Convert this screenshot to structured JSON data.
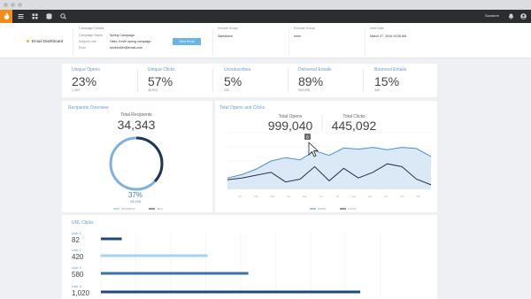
{
  "header": {
    "dashboard_title": "Email Dashboard",
    "campaign_details_label": "Campaign Details",
    "campaign_name_label": "Campaign Name",
    "campaign_name": "Spring Campaign",
    "subject_line_label": "Subject Line",
    "subject_line": "Hello, Kevin spring campaign",
    "from_label": "From",
    "from": "kevinmiller@email.com",
    "view_email_button": "View Email",
    "include_group_label": "Include Group",
    "include_group": "Salesforce",
    "exclude_group_label": "Exclude Group",
    "exclude_group": "none",
    "sent_date_label": "Sent Date",
    "sent_date": "March 27, 2016 10:55 AM"
  },
  "topbar": {
    "user_name": "Suzanne"
  },
  "stats": [
    {
      "label": "Unique Opens",
      "value": "23%",
      "sub": "1,409"
    },
    {
      "label": "Unique Clicks",
      "value": "57%",
      "sub": "38,903"
    },
    {
      "label": "Unsubscribes",
      "value": "5%",
      "sub": "200"
    },
    {
      "label": "Delivered Emails",
      "value": "89%",
      "sub": "383,998"
    },
    {
      "label": "Bounced Emails",
      "value": "15%",
      "sub": "349"
    }
  ],
  "recipients": {
    "title": "Recipients Overview",
    "total_label": "Total Recipients",
    "total": "34,343",
    "percent": "37%",
    "percent_fraction": 0.37,
    "sub": "15,204",
    "legend": [
      "RECIPIENTS",
      "SENT"
    ]
  },
  "opens_clicks": {
    "title": "Total Opens and Clicks",
    "opens_label": "Total Opens",
    "opens": "999,040",
    "clicks_label": "Total Clicks",
    "clicks": "445,092",
    "tooltip": "8",
    "legend": [
      "OPENS",
      "CLICKS"
    ]
  },
  "chart_data": {
    "type": "area",
    "x": [
      "Jan",
      "Feb",
      "Mar",
      "Apr",
      "May",
      "Jun",
      "Jul",
      "Aug",
      "Sep",
      "Oct",
      "Nov",
      "Dec"
    ],
    "series": [
      {
        "values": [
          20,
          26,
          36,
          50,
          56,
          52,
          68,
          60,
          73,
          71,
          74,
          70,
          74,
          72,
          58
        ]
      },
      {
        "values": [
          17,
          20,
          25,
          30,
          13,
          18,
          40,
          15,
          37,
          20,
          30,
          45,
          40,
          18,
          8
        ]
      }
    ],
    "ylim": [
      0,
      100
    ],
    "colors": [
      "#4d8fcf",
      "#1f3550"
    ]
  },
  "url_clicks": {
    "title": "URL Clicks",
    "links": [
      {
        "label": "Link 1",
        "value": "82",
        "amount": 82,
        "color": "#22477a"
      },
      {
        "label": "Link 2",
        "value": "420",
        "amount": 420,
        "color": "#a6d3ee"
      },
      {
        "label": "Link 3",
        "value": "580",
        "amount": 580,
        "color": "#3d6fa8"
      },
      {
        "label": "Link 4",
        "value": "1,020",
        "amount": 1020,
        "color": "#22477a"
      }
    ]
  }
}
